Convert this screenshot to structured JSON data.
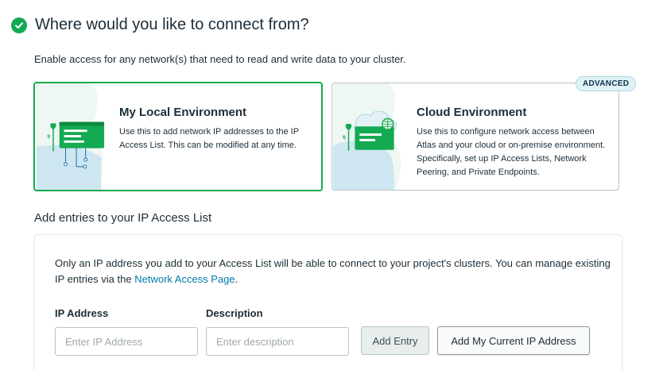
{
  "header": {
    "title": "Where would you like to connect from?"
  },
  "subtitle": "Enable access for any network(s) that need to read and write data to your cluster.",
  "options": {
    "local": {
      "title": "My Local Environment",
      "description": "Use this to add network IP addresses to the IP Access List. This can be modified at any time."
    },
    "cloud": {
      "badge": "ADVANCED",
      "title": "Cloud Environment",
      "description": "Use this to configure network access between Atlas and your cloud or on-premise environment. Specifically, set up IP Access Lists, Network Peering, and Private Endpoints."
    }
  },
  "access_list": {
    "section_title": "Add entries to your IP Access List",
    "info_text": "Only an IP address you add to your Access List will be able to connect to your project's clusters. You can manage existing IP entries via the ",
    "info_link": "Network Access Page",
    "info_end": ".",
    "ip_label": "IP Address",
    "ip_placeholder": "Enter IP Address",
    "ip_value": "",
    "description_label": "Description",
    "description_placeholder": "Enter description",
    "description_value": "",
    "add_entry_label": "Add Entry",
    "add_current_ip_label": "Add My Current IP Address"
  },
  "colors": {
    "accent_green": "#13aa52",
    "link_blue": "#007cad",
    "badge_bg": "#e1f2f6"
  },
  "icons": {
    "header": "check-circle-icon",
    "local_art": "local-environment-illustration",
    "cloud_art": "cloud-environment-illustration"
  }
}
